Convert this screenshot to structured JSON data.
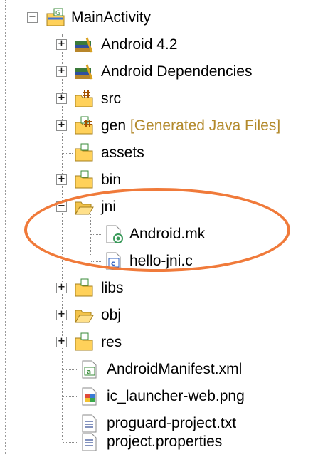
{
  "tree": {
    "root": {
      "label": "MainActivity",
      "icon": "project-icon",
      "expanded": true
    },
    "children": [
      {
        "label": "Android 4.2",
        "icon": "library-icon",
        "expandable": true
      },
      {
        "label": "Android Dependencies",
        "icon": "library-icon",
        "expandable": true
      },
      {
        "label": "src",
        "icon": "source-folder-icon",
        "expandable": true
      },
      {
        "label": "gen",
        "suffix": "[Generated Java Files]",
        "icon": "source-folder-icon",
        "expandable": true
      },
      {
        "label": "assets",
        "icon": "folder-icon",
        "expandable": false
      },
      {
        "label": "bin",
        "icon": "folder-icon",
        "expandable": true
      },
      {
        "label": "jni",
        "icon": "open-folder-icon",
        "expandable": true,
        "expanded": true,
        "children": [
          {
            "label": "Android.mk",
            "icon": "mk-file-icon"
          },
          {
            "label": "hello-jni.c",
            "icon": "c-file-icon"
          }
        ]
      },
      {
        "label": "libs",
        "icon": "folder-icon",
        "expandable": true
      },
      {
        "label": "obj",
        "icon": "open-folder-icon",
        "expandable": true
      },
      {
        "label": "res",
        "icon": "folder-icon",
        "expandable": true
      },
      {
        "label": "AndroidManifest.xml",
        "icon": "xml-file-icon",
        "expandable": false
      },
      {
        "label": "ic_launcher-web.png",
        "icon": "image-file-icon",
        "expandable": false
      },
      {
        "label": "proguard-project.txt",
        "icon": "text-file-icon",
        "expandable": false
      },
      {
        "label": "project.properties",
        "icon": "text-file-icon",
        "expandable": false
      }
    ]
  },
  "annotation_color": "#f07a3a"
}
